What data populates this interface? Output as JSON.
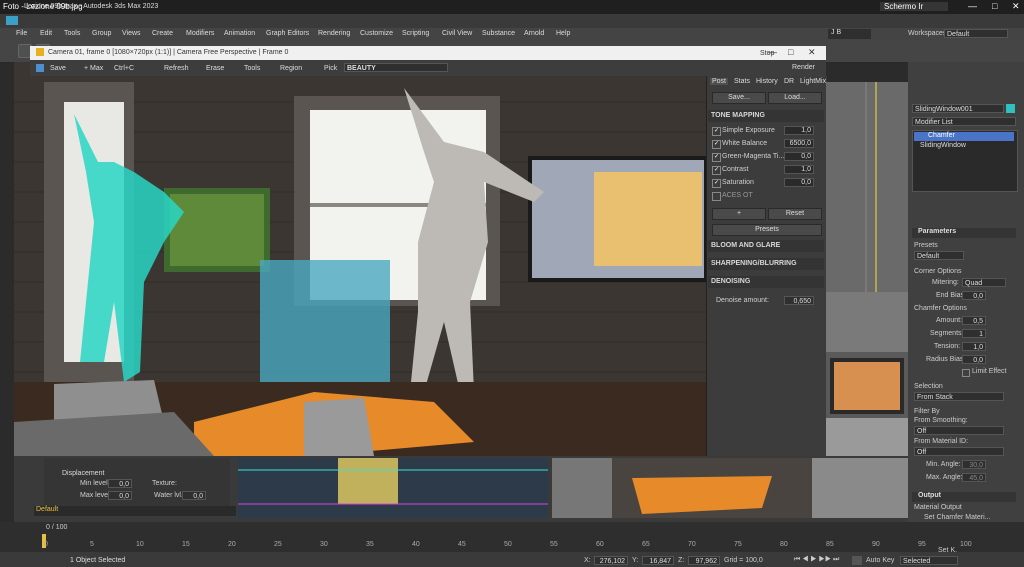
{
  "photo_window": {
    "title": "Foto - Lezione 09b.jpg",
    "tab": "Schermo Ir"
  },
  "max_window": {
    "title": "Lezione 09b.max - Autodesk 3ds Max 2023"
  },
  "menu": [
    "File",
    "Edit",
    "Tools",
    "Group",
    "Views",
    "Create",
    "Modifiers",
    "Animation",
    "Graph Editors",
    "Rendering",
    "Customize",
    "Scripting",
    "Civil View",
    "Substance",
    "Arnold",
    "Help"
  ],
  "user": "J B",
  "workspace": {
    "label": "Workspaces:",
    "value": "Default"
  },
  "render_frame": {
    "title": "Camera 01, frame 0 [1080×720px (1:1)] | Camera Free Perspective | Frame 0",
    "toolbar": {
      "save": "Save",
      "max": "+ Max",
      "ctrlc": "Ctrl+C",
      "refresh": "Refresh",
      "erase": "Erase",
      "tools": "Tools",
      "region": "Region",
      "pick": "Pick",
      "preset": "BEAUTY"
    },
    "tabs": [
      "Post",
      "Stats",
      "History",
      "DR",
      "LightMix"
    ],
    "save_btn": "Save...",
    "load_btn": "Load...",
    "tone_mapping": "TONE MAPPING",
    "tm_rows": [
      {
        "label": "Simple Exposure",
        "value": "1,0"
      },
      {
        "label": "White Balance",
        "value": "6500,0"
      },
      {
        "label": "Green-Magenta Ti...",
        "value": "0,0"
      },
      {
        "label": "Contrast",
        "value": "1,0"
      },
      {
        "label": "Saturation",
        "value": "0,0"
      },
      {
        "label": "ACES OT",
        "value": ""
      }
    ],
    "plus": "+",
    "reset": "Reset",
    "presets": "Presets",
    "bloom": "BLOOM AND GLARE",
    "sharpen": "SHARPENING/BLURRING",
    "denoising": "DENOISING",
    "denoise_label": "Denoise amount:",
    "denoise_value": "0,650",
    "render_btn": "Render",
    "stop_btn": "Stop"
  },
  "command_panel": {
    "object_name": "SlidingWindow001",
    "modifier_list": "Modifier List",
    "stack": [
      "Chamfer",
      "SlidingWindow"
    ],
    "parameters": "Parameters",
    "presets_label": "Presets",
    "presets_value": "Default",
    "corner_options": "Corner Options",
    "mitering_label": "Mitering:",
    "mitering_value": "Quad",
    "end_bias_label": "End Bias:",
    "end_bias_value": "0,0",
    "chamfer_options": "Chamfer Options",
    "amount_label": "Amount:",
    "amount_value": "0,5",
    "segments_label": "Segments:",
    "segments_value": "1",
    "tension_label": "Tension:",
    "tension_value": "1,0",
    "radius_label": "Radius Bias:",
    "radius_value": "0,0",
    "limit_effect": "Limit Effect",
    "selection": "Selection",
    "selection_value": "From Stack",
    "filter_by": "Filter By",
    "from_smoothing": "From Smoothing:",
    "smoothing_value": "Off",
    "from_material": "From Material ID:",
    "material_value": "Off",
    "min_angle_label": "Min. Angle:",
    "min_angle_value": "30,0",
    "max_angle_label": "Max. Angle:",
    "max_angle_value": "45,0",
    "output": "Output",
    "material_output": "Material Output",
    "set_chamfer": "Set Chamfer Materi..."
  },
  "bottom": {
    "displacement": "Displacement",
    "min_level_label": "Min level:",
    "min_level_value": "0,0",
    "max_level_label": "Max level:",
    "max_level_value": "0,0",
    "texture_label": "Texture:",
    "water_label": "Water lvl.",
    "water_value": "0,0",
    "default_label": "Default",
    "frame_counter": "0 / 100"
  },
  "timeline_ticks": [
    "0",
    "5",
    "10",
    "15",
    "20",
    "25",
    "30",
    "35",
    "40",
    "45",
    "50",
    "55",
    "60",
    "65",
    "70",
    "75",
    "80",
    "85",
    "90",
    "95",
    "100"
  ],
  "status": {
    "selected": "1 Object Selected",
    "x": "276,102",
    "y": "16,847",
    "z": "97,962",
    "grid": "Grid = 100,0",
    "autokey": "Auto Key",
    "selected_dd": "Selected",
    "setkey": "Set K."
  }
}
